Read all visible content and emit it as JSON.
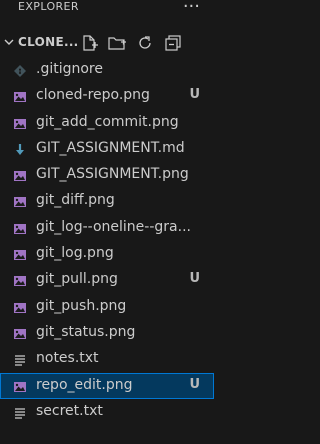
{
  "header": {
    "title": "EXPLORER",
    "more_label": "···"
  },
  "folder": {
    "name": "CLONE..."
  },
  "files": [
    {
      "name": ".gitignore",
      "icon": "gitignore-icon",
      "badge": ""
    },
    {
      "name": "cloned-repo.png",
      "icon": "image-icon",
      "badge": "U"
    },
    {
      "name": "git_add_commit.png",
      "icon": "image-icon",
      "badge": ""
    },
    {
      "name": "GIT_ASSIGNMENT.md",
      "icon": "markdown-icon",
      "badge": ""
    },
    {
      "name": "GIT_ASSIGNMENT.png",
      "icon": "image-icon",
      "badge": ""
    },
    {
      "name": "git_diff.png",
      "icon": "image-icon",
      "badge": ""
    },
    {
      "name": "git_log--oneline--graph.png",
      "display": "git_log--oneline--gra...",
      "icon": "image-icon",
      "badge": ""
    },
    {
      "name": "git_log.png",
      "icon": "image-icon",
      "badge": ""
    },
    {
      "name": "git_pull.png",
      "icon": "image-icon",
      "badge": "U"
    },
    {
      "name": "git_push.png",
      "icon": "image-icon",
      "badge": ""
    },
    {
      "name": "git_status.png",
      "icon": "image-icon",
      "badge": ""
    },
    {
      "name": "notes.txt",
      "icon": "text-file-icon",
      "badge": ""
    },
    {
      "name": "repo_edit.png",
      "icon": "image-icon",
      "badge": "U",
      "selected": true
    },
    {
      "name": "secret.txt",
      "icon": "text-file-icon",
      "badge": ""
    }
  ],
  "colors": {
    "background": "#181818",
    "selection": "#04395e",
    "selection_border": "#0078d4",
    "image_icon": "#a074c4",
    "markdown_icon": "#519aba"
  }
}
